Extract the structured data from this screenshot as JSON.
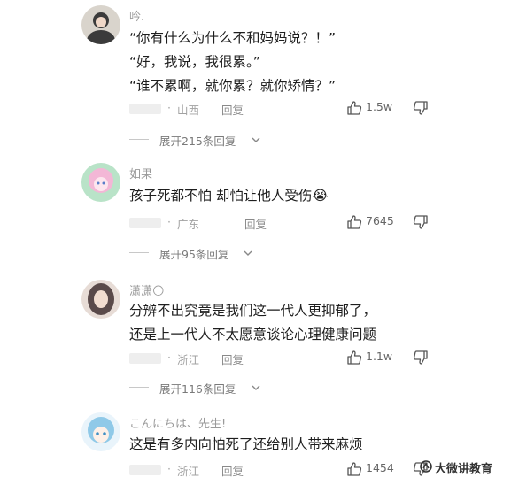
{
  "comments": [
    {
      "username": "吟.",
      "lines": [
        "“你有什么为什么不和妈妈说？！”",
        "“好，我说，我很累。”",
        "“谁不累啊，就你累？就你矫情？”"
      ],
      "dot": "·",
      "location": "山西",
      "reply": "回复",
      "likes": "1.5w",
      "expand": "展开215条回复",
      "avatar_colors": [
        "#3b3b3b",
        "#d9d4cc"
      ]
    },
    {
      "username": "如果",
      "lines": [
        "孩子死都不怕 却怕让他人受伤😭"
      ],
      "dot": "·",
      "location": "广东",
      "reply": "回复",
      "likes": "7645",
      "expand": "展开95条回复",
      "avatar_colors": [
        "#f3b7d6",
        "#b9e3c8"
      ]
    },
    {
      "username": "潇潇🌕",
      "lines": [
        "分辨不出究竟是我们这一代人更抑郁了，",
        "还是上一代人不太愿意谈论心理健康问题"
      ],
      "dot": "·",
      "location": "浙江",
      "reply": "回复",
      "likes": "1.1w",
      "expand": "展开116条回复",
      "avatar_colors": [
        "#5a4a4a",
        "#e7dcd6"
      ]
    },
    {
      "username": "こんにちは、先生!",
      "lines": [
        "这是有多内向怕死了还给别人带来麻烦"
      ],
      "dot": "·",
      "location": "浙江",
      "reply": "回复",
      "likes": "1454",
      "expand": "",
      "avatar_colors": [
        "#8fc9e8",
        "#e9f4fb"
      ]
    }
  ],
  "watermark": "大微讲教育",
  "icons": {
    "like": "thumbs-up-icon",
    "dislike": "thumbs-down-icon",
    "expand": "chevron-down-icon"
  }
}
